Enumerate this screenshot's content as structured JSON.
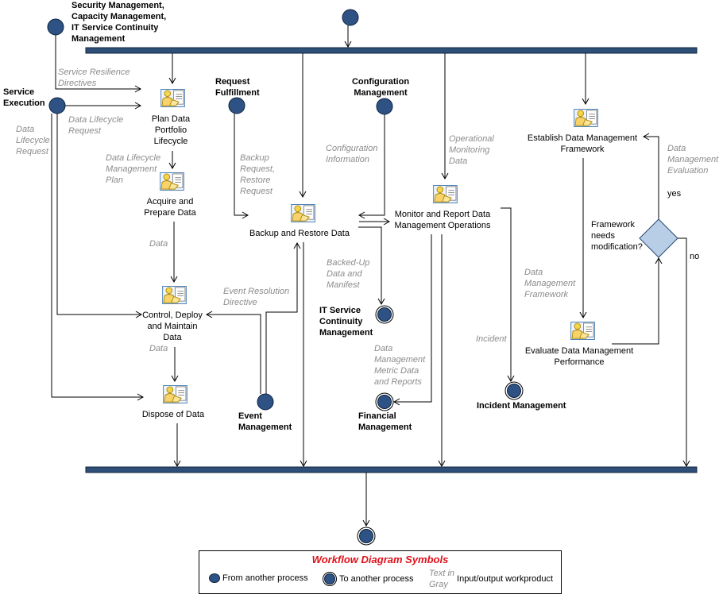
{
  "colors": {
    "bar": "#2e4f78",
    "circle": "#2e5283",
    "diamond": "#b8cde6",
    "legend_title": "#e0101a",
    "gray_text": "#8c8c8c"
  },
  "sources": {
    "security": "Security Management,\nCapacity Management,\nIT Service Continuity\nManagement",
    "service_execution": "Service\nExecution",
    "request_fulfillment": "Request\nFulfillment",
    "configuration": "Configuration\nManagement",
    "event": "Event\nManagement"
  },
  "targets": {
    "itscm": "IT Service\nContinuity\nManagement",
    "financial": "Financial\nManagement",
    "incident": "Incident Management"
  },
  "activities": {
    "plan": "Plan Data\nPortfolio\nLifecycle",
    "acquire": "Acquire and\nPrepare Data",
    "control": "Control, Deploy\nand Maintain\nData",
    "dispose": "Dispose of Data",
    "backup": "Backup and Restore Data",
    "monitor": "Monitor and Report Data\nManagement Operations",
    "establish": "Establish Data Management\nFramework",
    "evaluate": "Evaluate Data Management\nPerformance"
  },
  "decision": {
    "question": "Framework\nneeds\nmodification?",
    "yes": "yes",
    "no": "no"
  },
  "workproducts": {
    "service_resilience": "Service Resilience\nDirectives",
    "dlr1": "Data Lifecycle\nRequest",
    "dlr2": "Data\nLifecycle\nRequest",
    "dlm_plan": "Data Lifecycle\nManagement\nPlan",
    "data1": "Data",
    "data2": "Data",
    "event_resolution": "Event Resolution\nDirective",
    "backup_request": "Backup\nRequest,\nRestore\nRequest",
    "config_info": "Configuration\nInformation",
    "backed_up": "Backed-Up\nData and\nManifest",
    "op_monitoring": "Operational\nMonitoring\nData",
    "metric_data": "Data\nManagement\nMetric Data\nand Reports",
    "incident": "Incident",
    "dm_framework": "Data\nManagement\nFramework",
    "dm_evaluation": "Data\nManagement\nEvaluation"
  },
  "legend": {
    "title": "Workflow Diagram Symbols",
    "from": "From another process",
    "to": "To another process",
    "gray_sample": "Text in\nGray",
    "io": "Input/output workproduct"
  }
}
